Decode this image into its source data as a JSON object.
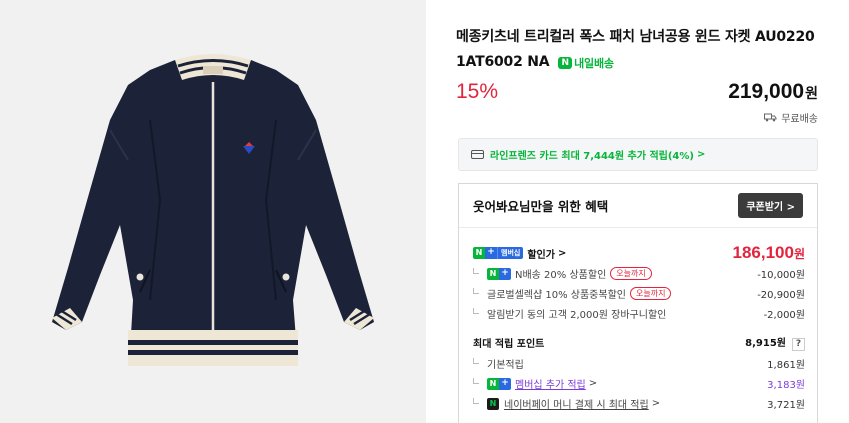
{
  "product": {
    "title": "메종키츠네 트리컬러 폭스 패치 남녀공용 윈드 자켓 AU0220 1AT6002 NA",
    "delivery_badge": "내일배송",
    "discount_rate": "15%",
    "price": "219,000",
    "price_unit": "원",
    "shipping": "무료배송"
  },
  "card_banner": {
    "text": "라인프렌즈 카드 최대 7,444원 추가 적립(4%)",
    "arrow": ">"
  },
  "benefit": {
    "title": "웃어봐요님만을 위한 혜택",
    "coupon_button": "쿠폰받기",
    "coupon_arrow": ">",
    "membership_badge": "멤버십",
    "discount_price_label": "할인가",
    "discount_price": "186,100",
    "discount_price_unit": "원",
    "discounts": [
      {
        "label": "N배송 20% 상품할인",
        "tag": "오늘까지",
        "value": "-10,000원"
      },
      {
        "label": "글로벌셀렉샵 10% 상품중복할인",
        "tag": "오늘까지",
        "value": "-20,900원"
      },
      {
        "label": "알림받기 동의 고객 2,000원 장바구니할인",
        "tag": "",
        "value": "-2,000원"
      }
    ],
    "points_label": "최대 적립 포인트",
    "points_value": "8,915원",
    "points_help": "?",
    "points": [
      {
        "label": "기본적립",
        "value": "1,861원"
      },
      {
        "label": "멤버십 추가 적립",
        "value": "3,183원"
      },
      {
        "label": "네이버페이 머니 결제 시 최대 적립",
        "value": "3,721원"
      }
    ]
  },
  "colors": {
    "accent_green": "#07b53b",
    "sale_red": "#e2253d",
    "membership_purple": "#7a3cd6",
    "naver_plus_blue": "#2a6ae0"
  }
}
